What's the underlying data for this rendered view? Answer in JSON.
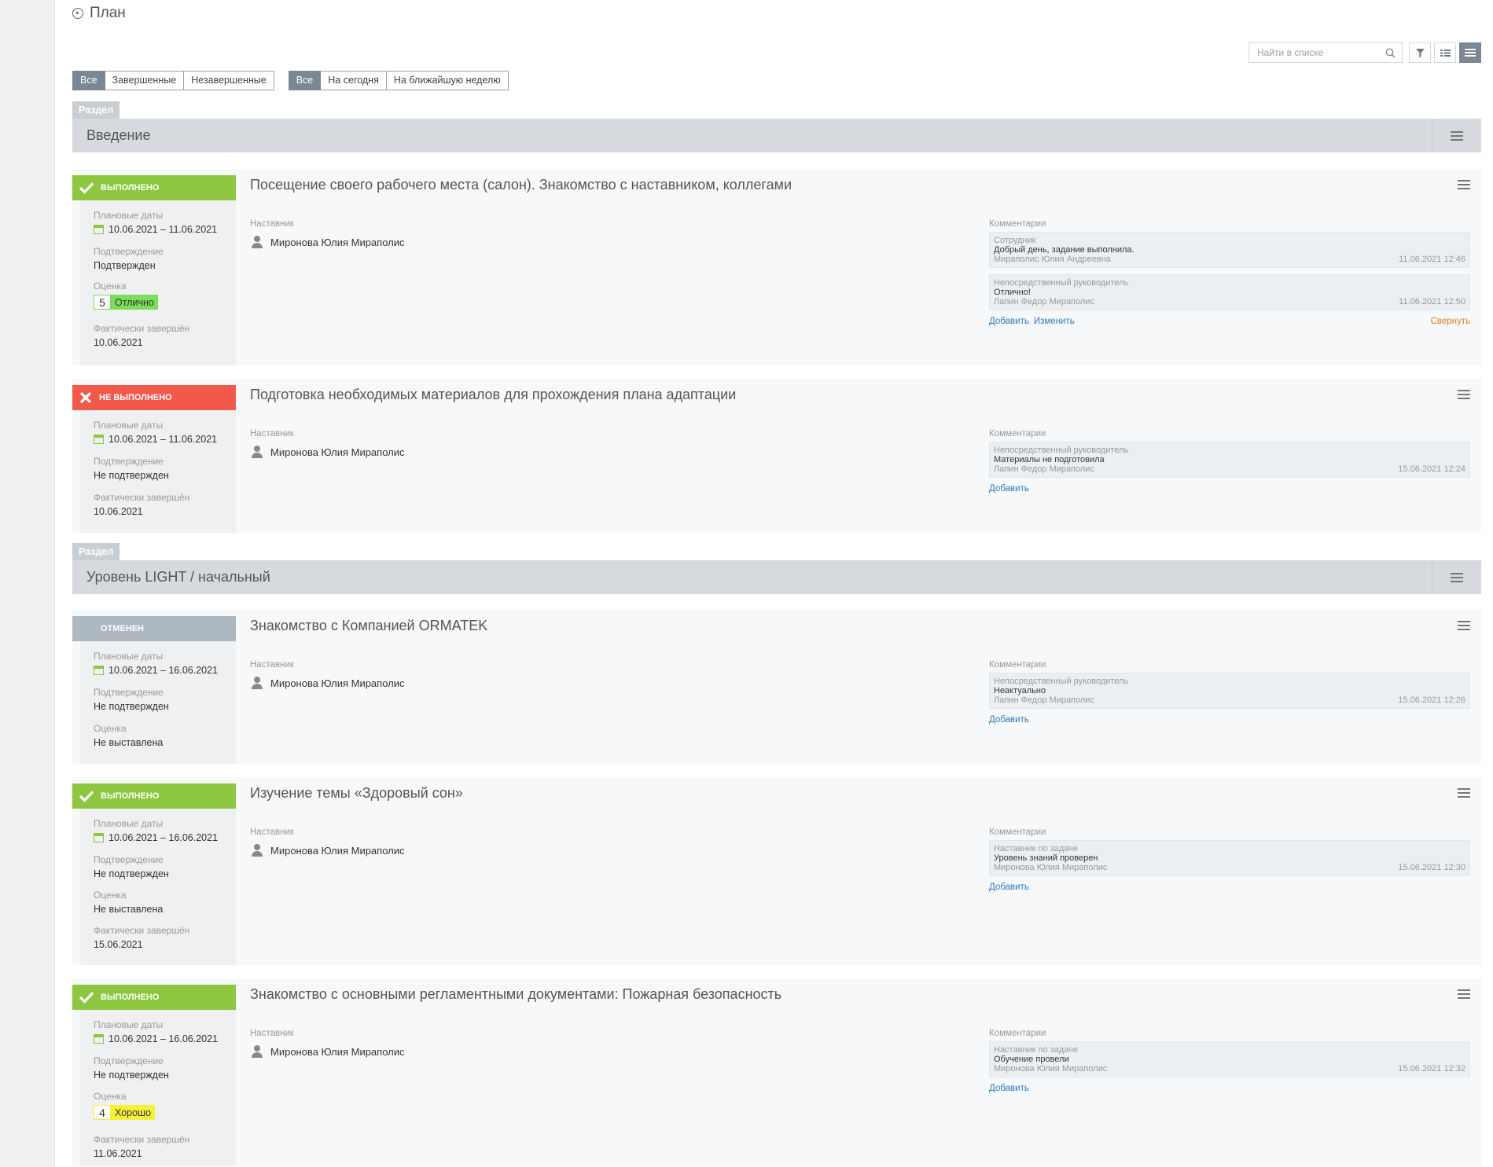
{
  "header": {
    "title": "План"
  },
  "toolbar": {
    "search_placeholder": "Найти в списке"
  },
  "filters": {
    "group1": [
      "Все",
      "Завершенные",
      "Незавершенные"
    ],
    "group2": [
      "Все",
      "На сегодня",
      "На ближайшую неделю"
    ]
  },
  "labels": {
    "section": "Раздел",
    "planned_dates": "Плановые даты",
    "confirmation": "Подтверждение",
    "grade": "Оценка",
    "actually_done": "Фактически завершён",
    "mentor": "Наставник",
    "comments": "Комментарии",
    "add": "Добавить",
    "edit": "Изменить",
    "collapse": "Свернуть"
  },
  "sections": [
    {
      "title": "Введение"
    },
    {
      "title": "Уровень LIGHT / начальный"
    }
  ],
  "tasks": [
    {
      "status": "выполнено",
      "title": "Посещение своего рабочего места (салон). Знакомство с наставником, коллегами",
      "dates": "10.06.2021 – 11.06.2021",
      "confirmation": "Подтвержден",
      "grade_num": "5",
      "grade_word": "Отлично",
      "actual": "10.06.2021",
      "mentor": "Миронова Юлия Мираполис",
      "comments": [
        {
          "role": "Сотрудник",
          "text": "Добрый день, задание выполнила.",
          "author": "Мираполис Юлия Андреевна",
          "date": "11.06.2021 12:46"
        },
        {
          "role": "Непосредственный руководитель",
          "text": "Отлично!",
          "author": "Лапин Федор Мираполис",
          "date": "11.06.2021 12:50"
        }
      ]
    },
    {
      "status": "не выполнено",
      "title": "Подготовка необходимых материалов для прохождения плана адаптации",
      "dates": "10.06.2021 – 11.06.2021",
      "confirmation": "Не подтвержден",
      "actual": "10.06.2021",
      "mentor": "Миронова Юлия Мираполис",
      "comments": [
        {
          "role": "Непосредственный руководитель",
          "text": "Материалы не подготовила",
          "author": "Лапин Федор Мираполис",
          "date": "15.06.2021 12:24"
        }
      ]
    },
    {
      "status": "отменен",
      "title": "Знакомство с Компанией ORMATEK",
      "dates": "10.06.2021 – 16.06.2021",
      "confirmation": "Не подтвержден",
      "grade_text": "Не выставлена",
      "mentor": "Миронова Юлия Мираполис",
      "comments": [
        {
          "role": "Непосредственный руководитель",
          "text": "Неактуально",
          "author": "Лапин Федор Мираполис",
          "date": "15.06.2021 12:26"
        }
      ]
    },
    {
      "status": "выполнено",
      "title": "Изучение темы «Здоровый сон»",
      "dates": "10.06.2021 – 16.06.2021",
      "confirmation": "Не подтвержден",
      "grade_text": "Не выставлена",
      "actual": "15.06.2021",
      "mentor": "Миронова Юлия Мираполис",
      "comments": [
        {
          "role": "Наставник по задаче",
          "text": "Уровень знаний проверен",
          "author": "Миронова Юлия Мираполис",
          "date": "15.06.2021 12:30"
        }
      ]
    },
    {
      "status": "выполнено",
      "title": "Знакомство с основными регламентными документами: Пожарная безопасность",
      "dates": "10.06.2021 – 16.06.2021",
      "confirmation": "Не подтвержден",
      "grade_num": "4",
      "grade_word": "Хорошо",
      "actual": "11.06.2021",
      "mentor": "Миронова Юлия Мираполис",
      "comments": [
        {
          "role": "Наставник по задаче",
          "text": "Обучение провели",
          "author": "Миронова Юлия Мираполис",
          "date": "15.06.2021 12:32"
        }
      ]
    }
  ]
}
